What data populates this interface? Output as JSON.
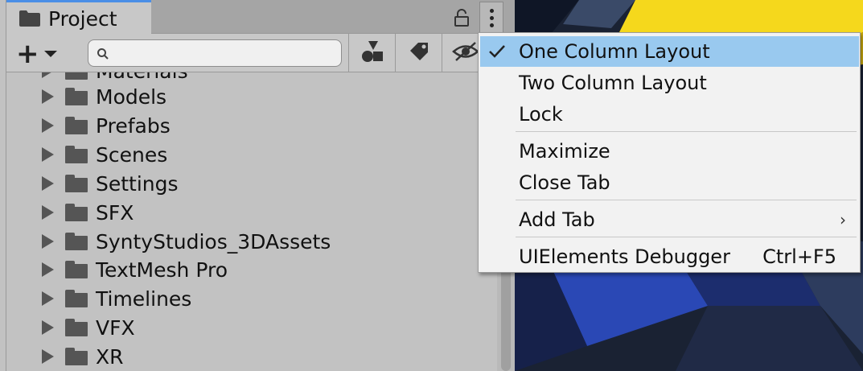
{
  "project_tab": {
    "title": "Project"
  },
  "toolbar": {
    "add_label": "+",
    "search": {
      "placeholder": "",
      "value": ""
    },
    "buttons": [
      "shapes-icon",
      "tag-icon",
      "eye-slash-icon"
    ]
  },
  "tree": {
    "partial_top_label": "Materials",
    "items": [
      {
        "label": "Models"
      },
      {
        "label": "Prefabs"
      },
      {
        "label": "Scenes"
      },
      {
        "label": "Settings"
      },
      {
        "label": "SFX"
      },
      {
        "label": "SyntyStudios_3DAssets"
      },
      {
        "label": "TextMesh Pro"
      },
      {
        "label": "Timelines"
      },
      {
        "label": "VFX"
      },
      {
        "label": "XR"
      }
    ]
  },
  "context_menu": {
    "items": [
      {
        "label": "One Column Layout",
        "checked": true
      },
      {
        "label": "Two Column Layout"
      },
      {
        "label": "Lock"
      },
      {
        "label": "Maximize"
      },
      {
        "label": "Close Tab"
      },
      {
        "label": "Add Tab",
        "submenu": true,
        "arrow": "›"
      },
      {
        "label": "UIElements Debugger",
        "shortcut": "Ctrl+F5"
      }
    ]
  },
  "colors": {
    "tab_accent": "#4a8ee6",
    "menu_highlight": "#99c9ef",
    "scene_yellow": "#f7dc1e",
    "scene_blue": "#2b4fb8"
  }
}
